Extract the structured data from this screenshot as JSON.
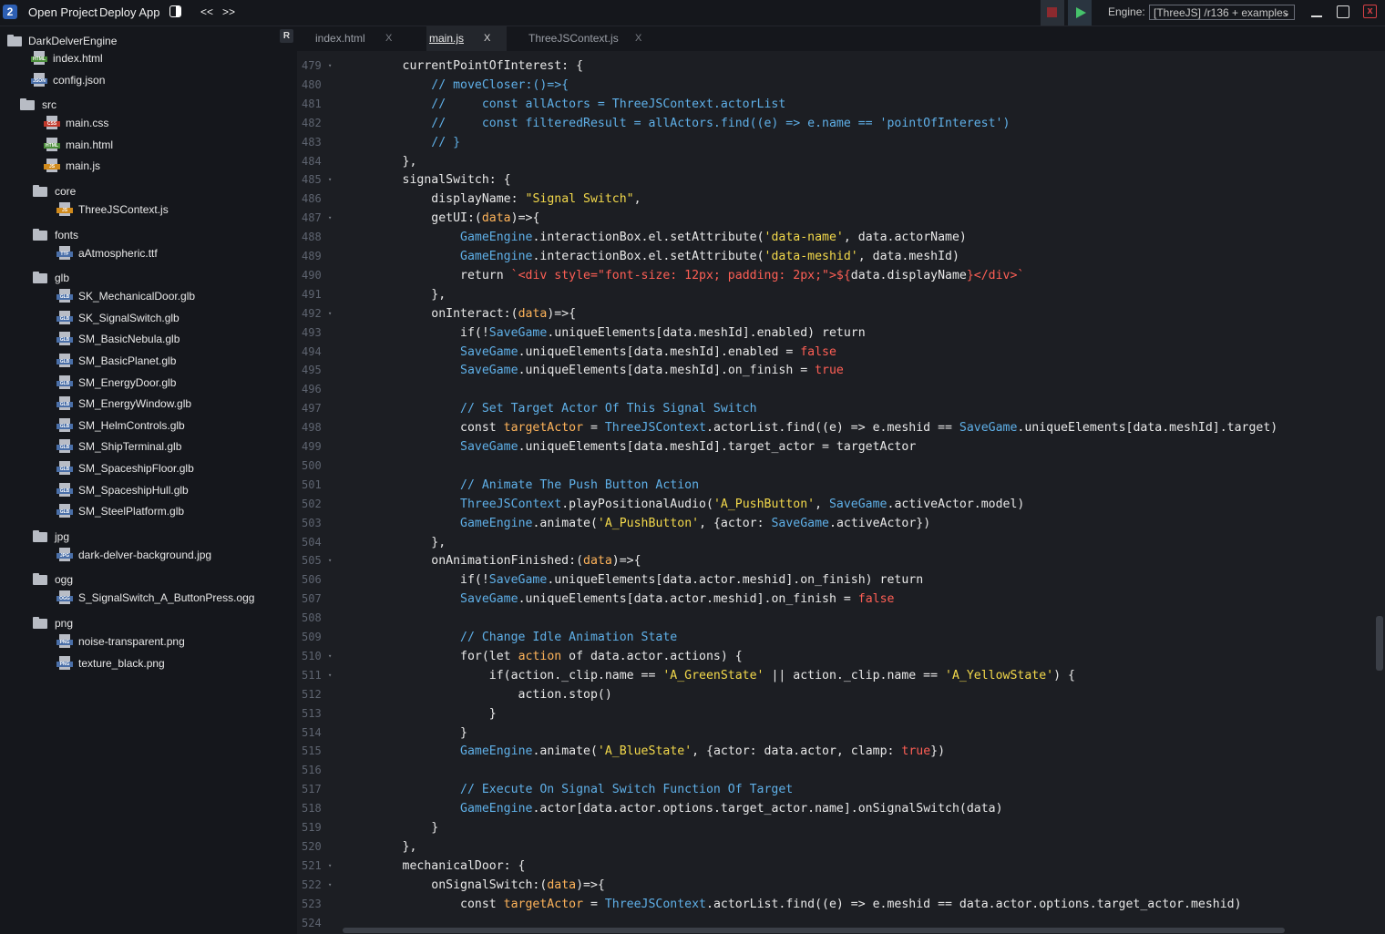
{
  "topbar": {
    "logo": "2",
    "open_project": "Open Project",
    "deploy_app": "Deploy App",
    "nav_back": "<<",
    "nav_forward": ">>",
    "engine_label": "Engine:",
    "engine_value": "[ThreeJS] /r136 + examples",
    "close_glyph": "x"
  },
  "sidebar": {
    "project_name": "DarkDelverEngine",
    "badge": "R",
    "items": [
      {
        "type": "file",
        "name": "index.html",
        "tag": "HTML",
        "color": "#4a8c3a",
        "depth": 1
      },
      {
        "type": "file",
        "name": "config.json",
        "tag": "JSON",
        "color": "#4a6fa8",
        "depth": 1
      },
      {
        "type": "folder",
        "name": "src",
        "depth": 1
      },
      {
        "type": "file",
        "name": "main.css",
        "tag": "CSS",
        "color": "#c0392b",
        "depth": 2
      },
      {
        "type": "file",
        "name": "main.html",
        "tag": "HTML",
        "color": "#4a8c3a",
        "depth": 2
      },
      {
        "type": "file",
        "name": "main.js",
        "tag": "JS",
        "color": "#d08a1c",
        "depth": 2
      },
      {
        "type": "folder",
        "name": "core",
        "depth": 2
      },
      {
        "type": "file",
        "name": "ThreeJSContext.js",
        "tag": "JS",
        "color": "#d08a1c",
        "depth": 3
      },
      {
        "type": "folder",
        "name": "fonts",
        "depth": 2
      },
      {
        "type": "file",
        "name": "aAtmospheric.ttf",
        "tag": "TTF",
        "color": "#4a6fa8",
        "depth": 3
      },
      {
        "type": "folder",
        "name": "glb",
        "depth": 2
      },
      {
        "type": "file",
        "name": "SK_MechanicalDoor.glb",
        "tag": "GLB",
        "color": "#4a6fa8",
        "depth": 3
      },
      {
        "type": "file",
        "name": "SK_SignalSwitch.glb",
        "tag": "GLB",
        "color": "#4a6fa8",
        "depth": 3
      },
      {
        "type": "file",
        "name": "SM_BasicNebula.glb",
        "tag": "GLB",
        "color": "#4a6fa8",
        "depth": 3
      },
      {
        "type": "file",
        "name": "SM_BasicPlanet.glb",
        "tag": "GLB",
        "color": "#4a6fa8",
        "depth": 3
      },
      {
        "type": "file",
        "name": "SM_EnergyDoor.glb",
        "tag": "GLB",
        "color": "#4a6fa8",
        "depth": 3
      },
      {
        "type": "file",
        "name": "SM_EnergyWindow.glb",
        "tag": "GLB",
        "color": "#4a6fa8",
        "depth": 3
      },
      {
        "type": "file",
        "name": "SM_HelmControls.glb",
        "tag": "GLB",
        "color": "#4a6fa8",
        "depth": 3
      },
      {
        "type": "file",
        "name": "SM_ShipTerminal.glb",
        "tag": "GLB",
        "color": "#4a6fa8",
        "depth": 3
      },
      {
        "type": "file",
        "name": "SM_SpaceshipFloor.glb",
        "tag": "GLB",
        "color": "#4a6fa8",
        "depth": 3
      },
      {
        "type": "file",
        "name": "SM_SpaceshipHull.glb",
        "tag": "GLB",
        "color": "#4a6fa8",
        "depth": 3
      },
      {
        "type": "file",
        "name": "SM_SteelPlatform.glb",
        "tag": "GLB",
        "color": "#4a6fa8",
        "depth": 3
      },
      {
        "type": "folder",
        "name": "jpg",
        "depth": 2
      },
      {
        "type": "file",
        "name": "dark-delver-background.jpg",
        "tag": "JPG",
        "color": "#4a6fa8",
        "depth": 3
      },
      {
        "type": "folder",
        "name": "ogg",
        "depth": 2
      },
      {
        "type": "file",
        "name": "S_SignalSwitch_A_ButtonPress.ogg",
        "tag": "OGG",
        "color": "#4a6fa8",
        "depth": 3
      },
      {
        "type": "folder",
        "name": "png",
        "depth": 2
      },
      {
        "type": "file",
        "name": "noise-transparent.png",
        "tag": "PNG",
        "color": "#4a6fa8",
        "depth": 3
      },
      {
        "type": "file",
        "name": "texture_black.png",
        "tag": "PNG",
        "color": "#4a6fa8",
        "depth": 3
      }
    ]
  },
  "tabs": [
    {
      "label": "index.html",
      "active": false
    },
    {
      "label": "main.js",
      "active": true
    },
    {
      "label": "ThreeJSContext.js",
      "active": false
    }
  ],
  "tab_close": "X",
  "editor": {
    "lines": [
      {
        "n": "479",
        "fold": true,
        "tokens": [
          [
            "k",
            "        currentPointOfInterest: {"
          ]
        ]
      },
      {
        "n": "480",
        "fold": false,
        "tokens": [
          [
            "c",
            "            // moveCloser:()=>{"
          ]
        ]
      },
      {
        "n": "481",
        "fold": false,
        "tokens": [
          [
            "c",
            "            //     const allActors = ThreeJSContext.actorList"
          ]
        ]
      },
      {
        "n": "482",
        "fold": false,
        "tokens": [
          [
            "c",
            "            //     const filteredResult = allActors.find((e) => e.name == 'pointOfInterest')"
          ]
        ]
      },
      {
        "n": "483",
        "fold": false,
        "tokens": [
          [
            "c",
            "            // }"
          ]
        ]
      },
      {
        "n": "484",
        "fold": false,
        "tokens": [
          [
            "k",
            "        },"
          ]
        ]
      },
      {
        "n": "485",
        "fold": true,
        "tokens": [
          [
            "k",
            "        signalSwitch: {"
          ]
        ]
      },
      {
        "n": "486",
        "fold": false,
        "tokens": [
          [
            "k",
            "            displayName: "
          ],
          [
            "s",
            "\"Signal Switch\""
          ],
          [
            "k",
            ","
          ]
        ]
      },
      {
        "n": "487",
        "fold": true,
        "tokens": [
          [
            "k",
            "            getUI:("
          ],
          [
            "v",
            "data"
          ],
          [
            "k",
            ")=>{"
          ]
        ]
      },
      {
        "n": "488",
        "fold": false,
        "tokens": [
          [
            "k",
            "                "
          ],
          [
            "c",
            "GameEngine"
          ],
          [
            "k",
            ".interactionBox.el.setAttribute("
          ],
          [
            "s",
            "'data-name'"
          ],
          [
            "k",
            ", data.actorName)"
          ]
        ]
      },
      {
        "n": "489",
        "fold": false,
        "tokens": [
          [
            "k",
            "                "
          ],
          [
            "c",
            "GameEngine"
          ],
          [
            "k",
            ".interactionBox.el.setAttribute("
          ],
          [
            "s",
            "'data-meshid'"
          ],
          [
            "k",
            ", data.meshId)"
          ]
        ]
      },
      {
        "n": "490",
        "fold": false,
        "tokens": [
          [
            "k",
            "                return "
          ],
          [
            "b",
            "`<div style=\"font-size: 12px; padding: 2px;\">${"
          ],
          [
            "k",
            "data.displayName"
          ],
          [
            "b",
            "}</div>`"
          ]
        ]
      },
      {
        "n": "491",
        "fold": false,
        "tokens": [
          [
            "k",
            "            },"
          ]
        ]
      },
      {
        "n": "492",
        "fold": true,
        "tokens": [
          [
            "k",
            "            onInteract:("
          ],
          [
            "v",
            "data"
          ],
          [
            "k",
            ")=>{"
          ]
        ]
      },
      {
        "n": "493",
        "fold": false,
        "tokens": [
          [
            "k",
            "                if(!"
          ],
          [
            "c",
            "SaveGame"
          ],
          [
            "k",
            ".uniqueElements[data.meshId].enabled) return"
          ]
        ]
      },
      {
        "n": "494",
        "fold": false,
        "tokens": [
          [
            "k",
            "                "
          ],
          [
            "c",
            "SaveGame"
          ],
          [
            "k",
            ".uniqueElements[data.meshId].enabled = "
          ],
          [
            "b",
            "false"
          ]
        ]
      },
      {
        "n": "495",
        "fold": false,
        "tokens": [
          [
            "k",
            "                "
          ],
          [
            "c",
            "SaveGame"
          ],
          [
            "k",
            ".uniqueElements[data.meshId].on_finish = "
          ],
          [
            "b",
            "true"
          ]
        ]
      },
      {
        "n": "496",
        "fold": false,
        "tokens": []
      },
      {
        "n": "497",
        "fold": false,
        "tokens": [
          [
            "c",
            "                // Set Target Actor Of This Signal Switch"
          ]
        ]
      },
      {
        "n": "498",
        "fold": false,
        "tokens": [
          [
            "k",
            "                const "
          ],
          [
            "v",
            "targetActor"
          ],
          [
            "k",
            " = "
          ],
          [
            "c",
            "ThreeJSContext"
          ],
          [
            "k",
            ".actorList.find((e) => e.meshid == "
          ],
          [
            "c",
            "SaveGame"
          ],
          [
            "k",
            ".uniqueElements[data.meshId].target)"
          ]
        ]
      },
      {
        "n": "499",
        "fold": false,
        "tokens": [
          [
            "k",
            "                "
          ],
          [
            "c",
            "SaveGame"
          ],
          [
            "k",
            ".uniqueElements[data.meshId].target_actor = targetActor"
          ]
        ]
      },
      {
        "n": "500",
        "fold": false,
        "tokens": []
      },
      {
        "n": "501",
        "fold": false,
        "tokens": [
          [
            "c",
            "                // Animate The Push Button Action"
          ]
        ]
      },
      {
        "n": "502",
        "fold": false,
        "tokens": [
          [
            "k",
            "                "
          ],
          [
            "c",
            "ThreeJSContext"
          ],
          [
            "k",
            ".playPositionalAudio("
          ],
          [
            "s",
            "'A_PushButton'"
          ],
          [
            "k",
            ", "
          ],
          [
            "c",
            "SaveGame"
          ],
          [
            "k",
            ".activeActor.model)"
          ]
        ]
      },
      {
        "n": "503",
        "fold": false,
        "tokens": [
          [
            "k",
            "                "
          ],
          [
            "c",
            "GameEngine"
          ],
          [
            "k",
            ".animate("
          ],
          [
            "s",
            "'A_PushButton'"
          ],
          [
            "k",
            ", {actor: "
          ],
          [
            "c",
            "SaveGame"
          ],
          [
            "k",
            ".activeActor})"
          ]
        ]
      },
      {
        "n": "504",
        "fold": false,
        "tokens": [
          [
            "k",
            "            },"
          ]
        ]
      },
      {
        "n": "505",
        "fold": true,
        "tokens": [
          [
            "k",
            "            onAnimationFinished:("
          ],
          [
            "v",
            "data"
          ],
          [
            "k",
            ")=>{"
          ]
        ]
      },
      {
        "n": "506",
        "fold": false,
        "tokens": [
          [
            "k",
            "                if(!"
          ],
          [
            "c",
            "SaveGame"
          ],
          [
            "k",
            ".uniqueElements[data.actor.meshid].on_finish) return"
          ]
        ]
      },
      {
        "n": "507",
        "fold": false,
        "tokens": [
          [
            "k",
            "                "
          ],
          [
            "c",
            "SaveGame"
          ],
          [
            "k",
            ".uniqueElements[data.actor.meshid].on_finish = "
          ],
          [
            "b",
            "false"
          ]
        ]
      },
      {
        "n": "508",
        "fold": false,
        "tokens": []
      },
      {
        "n": "509",
        "fold": false,
        "tokens": [
          [
            "c",
            "                // Change Idle Animation State"
          ]
        ]
      },
      {
        "n": "510",
        "fold": true,
        "tokens": [
          [
            "k",
            "                for(let "
          ],
          [
            "v",
            "action"
          ],
          [
            "k",
            " of data.actor.actions) {"
          ]
        ]
      },
      {
        "n": "511",
        "fold": true,
        "tokens": [
          [
            "k",
            "                    if(action._clip.name == "
          ],
          [
            "s",
            "'A_GreenState'"
          ],
          [
            "k",
            " || action._clip.name == "
          ],
          [
            "s",
            "'A_YellowState'"
          ],
          [
            "k",
            ") {"
          ]
        ]
      },
      {
        "n": "512",
        "fold": false,
        "tokens": [
          [
            "k",
            "                        action.stop()"
          ]
        ]
      },
      {
        "n": "513",
        "fold": false,
        "tokens": [
          [
            "k",
            "                    }"
          ]
        ]
      },
      {
        "n": "514",
        "fold": false,
        "tokens": [
          [
            "k",
            "                }"
          ]
        ]
      },
      {
        "n": "515",
        "fold": false,
        "tokens": [
          [
            "k",
            "                "
          ],
          [
            "c",
            "GameEngine"
          ],
          [
            "k",
            ".animate("
          ],
          [
            "s",
            "'A_BlueState'"
          ],
          [
            "k",
            ", {actor: data.actor, clamp: "
          ],
          [
            "b",
            "true"
          ],
          [
            "k",
            "})"
          ]
        ]
      },
      {
        "n": "516",
        "fold": false,
        "tokens": []
      },
      {
        "n": "517",
        "fold": false,
        "tokens": [
          [
            "c",
            "                // Execute On Signal Switch Function Of Target"
          ]
        ]
      },
      {
        "n": "518",
        "fold": false,
        "tokens": [
          [
            "k",
            "                "
          ],
          [
            "c",
            "GameEngine"
          ],
          [
            "k",
            ".actor[data.actor.options.target_actor.name].onSignalSwitch(data)"
          ]
        ]
      },
      {
        "n": "519",
        "fold": false,
        "tokens": [
          [
            "k",
            "            }"
          ]
        ]
      },
      {
        "n": "520",
        "fold": false,
        "tokens": [
          [
            "k",
            "        },"
          ]
        ]
      },
      {
        "n": "521",
        "fold": true,
        "tokens": [
          [
            "k",
            "        mechanicalDoor: {"
          ]
        ]
      },
      {
        "n": "522",
        "fold": true,
        "tokens": [
          [
            "k",
            "            onSignalSwitch:("
          ],
          [
            "v",
            "data"
          ],
          [
            "k",
            ")=>{"
          ]
        ]
      },
      {
        "n": "523",
        "fold": false,
        "tokens": [
          [
            "k",
            "                const "
          ],
          [
            "v",
            "targetActor"
          ],
          [
            "k",
            " = "
          ],
          [
            "c",
            "ThreeJSContext"
          ],
          [
            "k",
            ".actorList.find((e) => e.meshid == data.actor.options.target_actor.meshid)"
          ]
        ]
      },
      {
        "n": "524",
        "fold": false,
        "tokens": []
      }
    ]
  }
}
